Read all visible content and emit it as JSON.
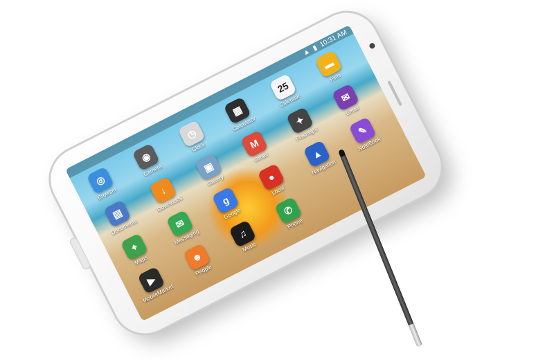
{
  "status_bar": {
    "time": "10:31 AM"
  },
  "calendar_day": "25",
  "apps": [
    {
      "label": "Browser",
      "icon": "globe-icon",
      "color": "#3a8fe0"
    },
    {
      "label": "Camera",
      "icon": "camera-icon",
      "color": "#5b5b5b"
    },
    {
      "label": "Clock",
      "icon": "clock-icon",
      "color": "#d9d9d9"
    },
    {
      "label": "Calculator",
      "icon": "calculator-icon",
      "color": "#2f2f2f"
    },
    {
      "label": "Calendar",
      "icon": "calendar-icon",
      "color": "#f5f5f5"
    },
    {
      "label": "Files",
      "icon": "folder-icon",
      "color": "#f3b21a"
    },
    {
      "label": "Documents",
      "icon": "documents-icon",
      "color": "#4a79c8"
    },
    {
      "label": "Downloads",
      "icon": "download-icon",
      "color": "#f08a1c"
    },
    {
      "label": "Gallery",
      "icon": "gallery-icon",
      "color": "#7aa2c8"
    },
    {
      "label": "Gmail",
      "icon": "gmail-icon",
      "color": "#e04a3b"
    },
    {
      "label": "Flashlight",
      "icon": "flashlight-icon",
      "color": "#444444"
    },
    {
      "label": "Email",
      "icon": "email-icon",
      "color": "#7a3fb0"
    },
    {
      "label": "Maps",
      "icon": "maps-icon",
      "color": "#3fa14c"
    },
    {
      "label": "Messaging",
      "icon": "message-icon",
      "color": "#34a853"
    },
    {
      "label": "Google",
      "icon": "google-icon",
      "color": "#3b78e7"
    },
    {
      "label": "Local",
      "icon": "pin-icon",
      "color": "#d93025"
    },
    {
      "label": "Navigation",
      "icon": "navigation-icon",
      "color": "#2a62c9"
    },
    {
      "label": "NoteBook",
      "icon": "note-icon",
      "color": "#8a4bd6"
    },
    {
      "label": "MobileMarket",
      "icon": "market-icon",
      "color": "#2a2a2a"
    },
    {
      "label": "People",
      "icon": "contacts-icon",
      "color": "#f07b2a"
    },
    {
      "label": "Music",
      "icon": "music-icon",
      "color": "#1b1b1b"
    },
    {
      "label": "Phone",
      "icon": "phone-icon",
      "color": "#2fa34d"
    }
  ]
}
